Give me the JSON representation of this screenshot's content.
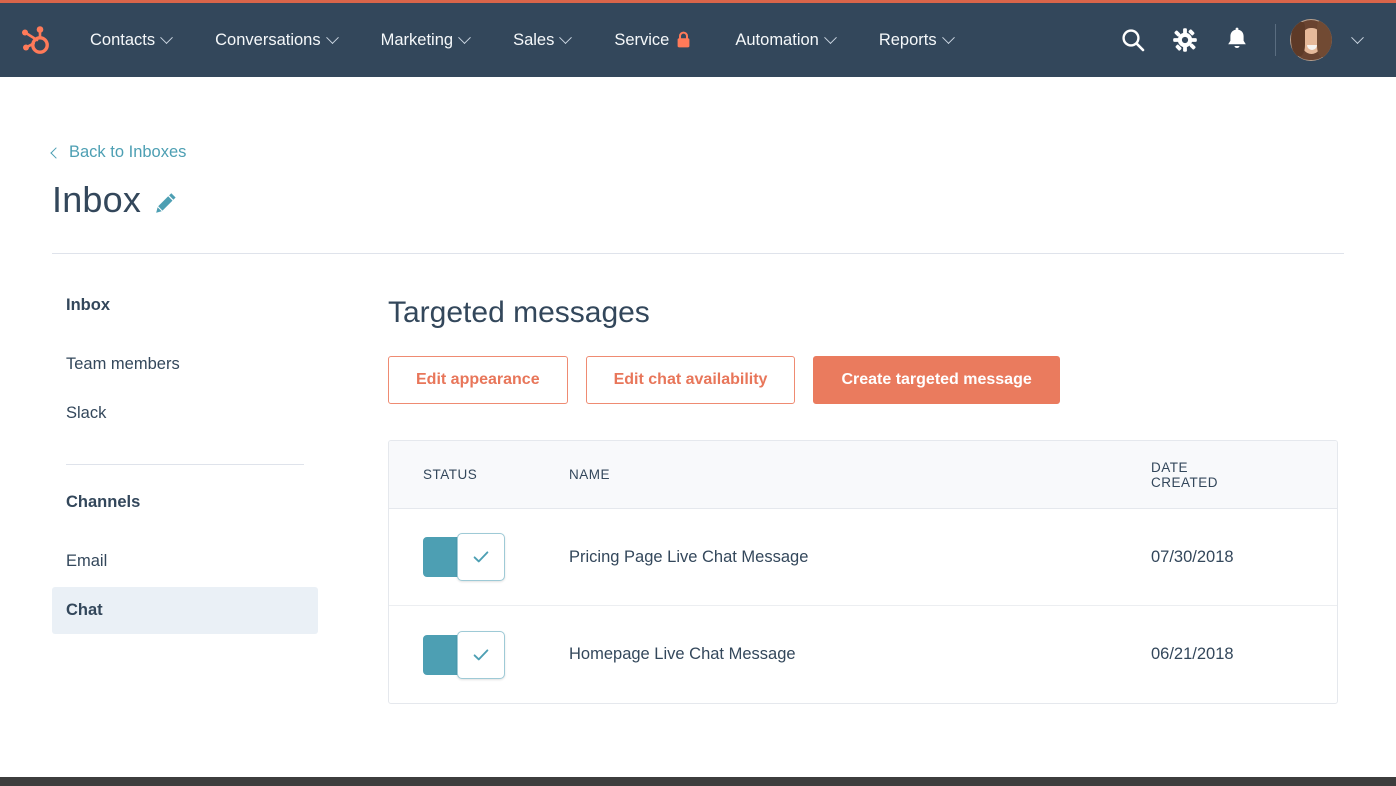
{
  "brand": {
    "accent_salmon": "#ea7b5e",
    "accent_teal": "#4d9fb3",
    "nav_background": "#33475b",
    "logo_name": "hubspot-sprocket-logo"
  },
  "navbar": {
    "items": [
      {
        "label": "Contacts",
        "has_caret": true,
        "has_lock": false
      },
      {
        "label": "Conversations",
        "has_caret": true,
        "has_lock": false
      },
      {
        "label": "Marketing",
        "has_caret": true,
        "has_lock": false
      },
      {
        "label": "Sales",
        "has_caret": true,
        "has_lock": false
      },
      {
        "label": "Service",
        "has_caret": false,
        "has_lock": true
      },
      {
        "label": "Automation",
        "has_caret": true,
        "has_lock": false
      },
      {
        "label": "Reports",
        "has_caret": true,
        "has_lock": false
      }
    ],
    "actions": [
      {
        "icon": "search-icon"
      },
      {
        "icon": "gear-icon"
      },
      {
        "icon": "bell-icon"
      }
    ],
    "avatar_name": "user-avatar",
    "avatar_caret_icon": "chevron-down-icon"
  },
  "header": {
    "back_link": "Back to Inboxes",
    "back_icon": "chevron-left-icon",
    "title": "Inbox",
    "edit_icon": "pencil-icon"
  },
  "sidebar": {
    "group_inbox": {
      "heading": "Inbox",
      "items": [
        {
          "label": "Team members",
          "selected": false
        },
        {
          "label": "Slack",
          "selected": false
        }
      ]
    },
    "group_channels": {
      "heading": "Channels",
      "items": [
        {
          "label": "Email",
          "selected": false
        },
        {
          "label": "Chat",
          "selected": true
        }
      ]
    }
  },
  "main": {
    "section_title": "Targeted messages",
    "buttons": [
      {
        "label": "Edit appearance",
        "style": "outline"
      },
      {
        "label": "Edit chat availability",
        "style": "outline"
      },
      {
        "label": "Create targeted message",
        "style": "primary"
      }
    ],
    "table": {
      "columns": {
        "status": "STATUS",
        "name": "NAME",
        "date_created_line1": "DATE",
        "date_created_line2": "CREATED"
      },
      "rows": [
        {
          "status_on": true,
          "status_icon": "check-icon",
          "name": "Pricing Page Live Chat Message",
          "date_created": "07/30/2018"
        },
        {
          "status_on": true,
          "status_icon": "check-icon",
          "name": "Homepage Live Chat Message",
          "date_created": "06/21/2018"
        }
      ]
    }
  }
}
